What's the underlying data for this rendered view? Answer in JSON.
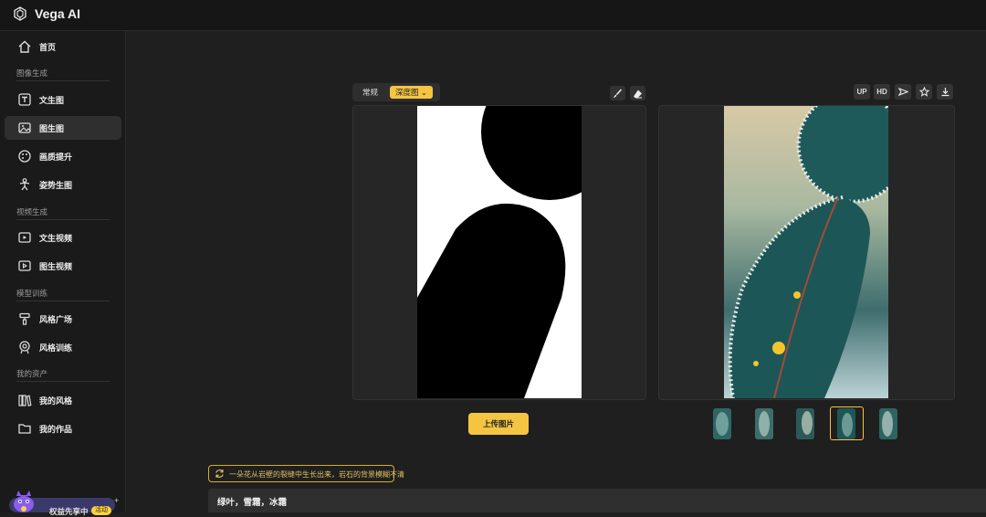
{
  "app": {
    "title": "Vega AI"
  },
  "sidebar": {
    "home": "首页",
    "sections": {
      "image_gen": "图像生成",
      "video_gen": "视频生成",
      "model_train": "模型训练",
      "assets": "我的资产"
    },
    "items": [
      {
        "label": "文生图",
        "icon": "text-icon"
      },
      {
        "label": "图生图",
        "icon": "image-icon",
        "active": true
      },
      {
        "label": "画质提升",
        "icon": "palette-icon"
      },
      {
        "label": "姿势生图",
        "icon": "pose-icon"
      },
      {
        "label": "文生视频",
        "icon": "text-video-icon"
      },
      {
        "label": "图生视频",
        "icon": "image-video-icon"
      },
      {
        "label": "风格广场",
        "icon": "style-plaza-icon"
      },
      {
        "label": "风格训练",
        "icon": "style-train-icon"
      },
      {
        "label": "我的风格",
        "icon": "books-icon"
      },
      {
        "label": "我的作品",
        "icon": "folder-icon"
      }
    ],
    "promo": {
      "text": "权益先享中",
      "badge": "活动",
      "plus": "+"
    }
  },
  "editor": {
    "tabs": {
      "normal": "常规",
      "depth": "深度图",
      "depth_chevron": "⌄"
    },
    "upload_label": "上传图片"
  },
  "output": {
    "buttons": {
      "up": "UP",
      "hd": "HD"
    },
    "selected_thumbnail": 4
  },
  "prompt": {
    "suggestion": "一朵花从岩壁的裂缝中生长出来，岩石的背景模糊不清",
    "value": "绿叶，雪霜，冰霜"
  },
  "colors": {
    "accent": "#f5c542",
    "bg": "#1f1f1f",
    "sidebar": "#1a1a1a",
    "panel": "#262626"
  }
}
